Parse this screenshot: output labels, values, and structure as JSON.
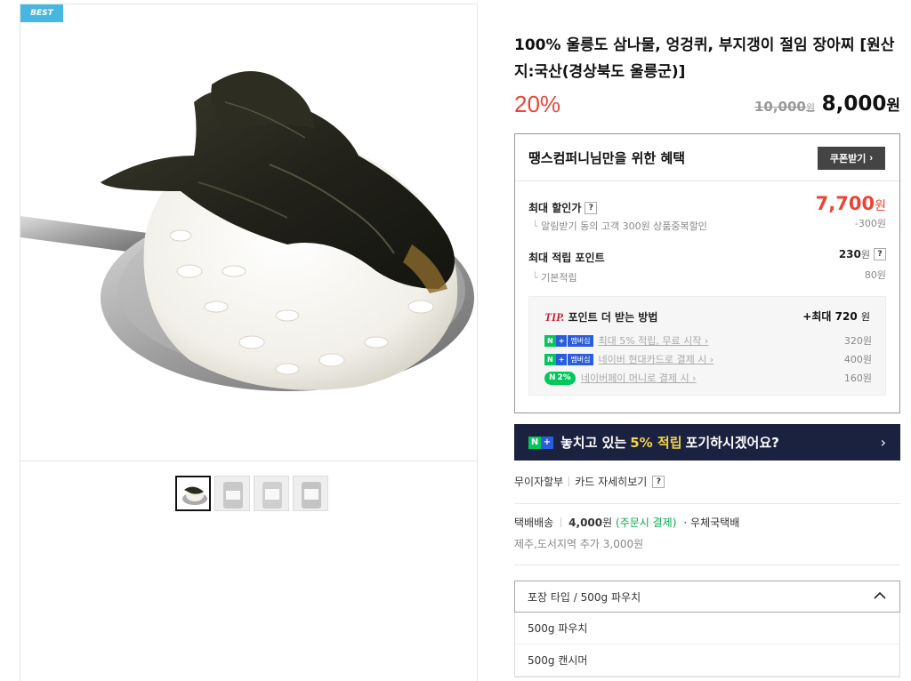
{
  "gallery": {
    "badge": "BEST",
    "thumbnails": [
      "thumb-1",
      "thumb-2",
      "thumb-3",
      "thumb-4"
    ],
    "active_index": 0
  },
  "product": {
    "title": "100% 울릉도 삼나물, 엉겅퀴, 부지갱이 절임 장아찌 [원산지:국산(경상북도 울릉군)]",
    "discount_rate": "20%",
    "original_price": "10,000",
    "original_unit": "원",
    "sale_price": "8,000",
    "sale_unit": "원"
  },
  "benefit": {
    "title": "땡스컴퍼니님만을 위한 혜택",
    "coupon_label": "쿠폰받기",
    "max_discount_label": "최대 할인가",
    "max_discount_price": "7,700",
    "max_discount_unit": "원",
    "alarm_label": "알림받기 동의 고객 300원 상품중복할인",
    "alarm_value": "-300원",
    "max_point_label": "최대 적립 포인트",
    "max_point_value": "230",
    "max_point_unit": "원",
    "base_point_label": "기본적립",
    "base_point_value": "80원",
    "tip": {
      "mark": "TIP.",
      "title": "포인트 더 받는 방법",
      "max_label": "+최대",
      "max_value": "720",
      "max_unit": "원",
      "items": [
        {
          "badge": "멤버십",
          "text": "최대 5% 적립, 무료 시작",
          "value": "320원"
        },
        {
          "badge": "멤버십",
          "text": "네이버 현대카드로 결제 시",
          "value": "400원"
        },
        {
          "badge": "2%",
          "text": "네이버페이 머니로 결제 시",
          "value": "160원"
        }
      ]
    }
  },
  "banner": {
    "prefix": "놓치고 있는",
    "highlight": "5% 적립",
    "suffix": "포기하시겠어요?"
  },
  "installment": {
    "label": "무이자할부",
    "link": "카드 자세히보기"
  },
  "shipping": {
    "label": "택배배송",
    "price": "4,000",
    "unit": "원",
    "note": "(주문시 결제)",
    "carrier": "· 우체국택배",
    "extra": "제주,도서지역 추가 3,000원"
  },
  "option": {
    "selected": "포장 타입 / 500g 파우치",
    "options": [
      "500g 파우치",
      "500g 캔시머"
    ]
  },
  "colors": {
    "accent_red": "#e9463a",
    "banner_bg": "#1a2240",
    "naver_green": "#03c75a",
    "badge_blue": "#47b7e2"
  }
}
